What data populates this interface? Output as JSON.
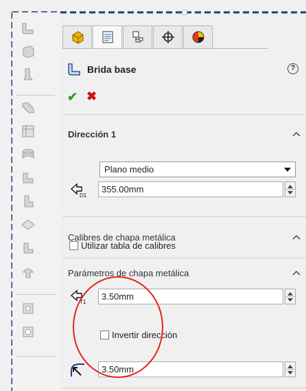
{
  "left_toolbar": {
    "icons": [
      "flange-icon",
      "box-icon",
      "edge-flange-icon",
      "miter-flange-icon",
      "hem-icon",
      "jog-icon",
      "sketched-bend-icon",
      "cross-break-icon",
      "corner-icon",
      "forming-tool-icon",
      "extruded-cut-icon",
      "simple-hole-icon"
    ]
  },
  "property_manager": {
    "tabs": [
      "feature-manager-tab",
      "property-manager-tab",
      "configuration-manager-tab",
      "dimxpert-tab",
      "display-manager-tab"
    ],
    "feature_title": "Brida base",
    "help_label": "?",
    "ok_label": "✔",
    "cancel_label": "✖"
  },
  "direction1": {
    "title": "Dirección 1",
    "end_condition": "Plano medio",
    "depth_value": "355.00mm",
    "depth_icon_label": "D1"
  },
  "gauge": {
    "title": "Calibres de chapa metálica",
    "use_gauge_table_label": "Utilizar tabla de calibres"
  },
  "sheet_metal_params": {
    "title": "Parámetros de chapa metálica",
    "thickness_value": "3.50mm",
    "thickness_icon_label": "T1",
    "reverse_direction_label": "Invertir dirección",
    "bend_radius_value": "3.50mm"
  },
  "colors": {
    "ok": "#2ea02e",
    "cancel": "#d01010",
    "highlight_circle": "#e2231a",
    "frame_dash": "#1f3d7a"
  }
}
